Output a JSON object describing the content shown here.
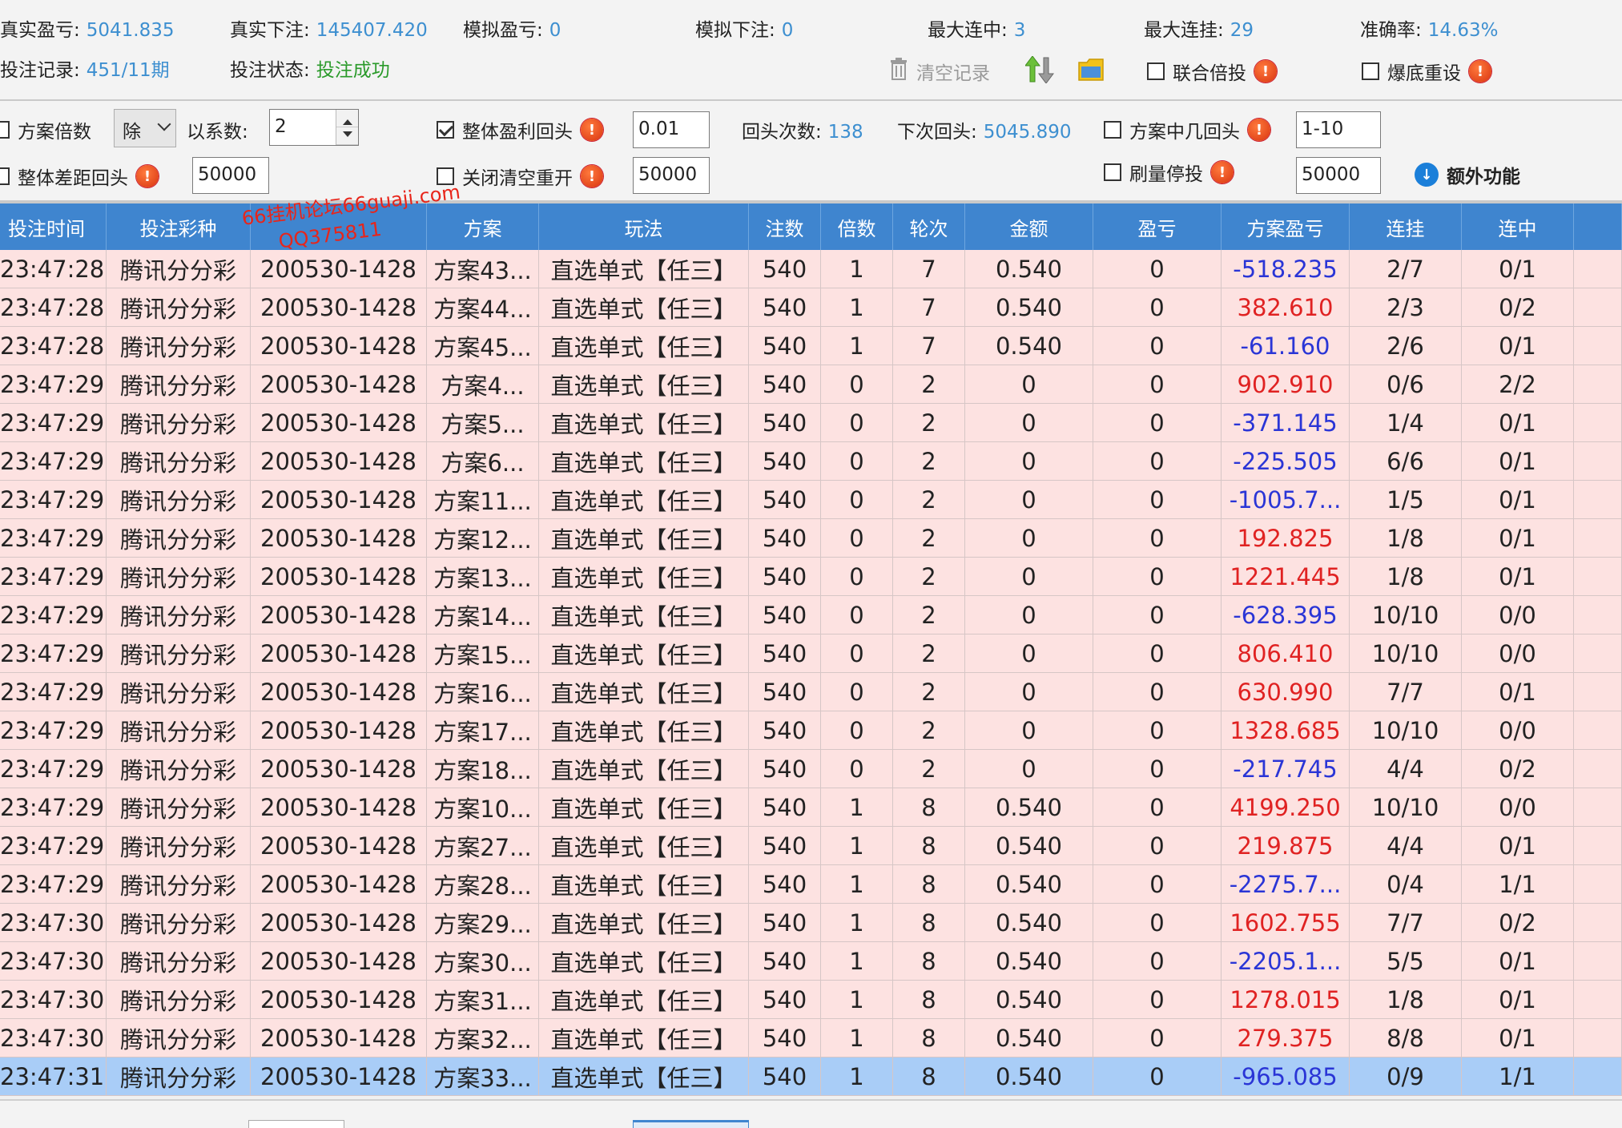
{
  "stats": {
    "real_profit_label": "真实盈亏:",
    "real_profit": "5041.835",
    "real_bet_label": "真实下注:",
    "real_bet": "145407.420",
    "sim_profit_label": "模拟盈亏:",
    "sim_profit": "0",
    "sim_bet_label": "模拟下注:",
    "sim_bet": "0",
    "max_win_streak_label": "最大连中:",
    "max_win_streak": "3",
    "max_loss_streak_label": "最大连挂:",
    "max_loss_streak": "29",
    "accuracy_label": "准确率:",
    "accuracy": "14.63%",
    "bet_record_label": "投注记录:",
    "bet_record": "451/11期",
    "bet_status_label": "投注状态:",
    "bet_status": "投注成功"
  },
  "toolbar": {
    "clear_records": "清空记录",
    "joint_multiplier": "联合倍投",
    "full_reset": "爆底重设"
  },
  "settings": {
    "plan_multiplier_label": "方案倍数",
    "divide_select": "除",
    "coefficient_label": "以系数:",
    "coefficient_value": "2",
    "overall_profit_return_label": "整体盈利回头",
    "overall_profit_return_value": "0.01",
    "return_count_label": "回头次数:",
    "return_count": "138",
    "next_return_label": "下次回头:",
    "next_return": "5045.890",
    "plan_hit_return_label": "方案中几回头",
    "plan_hit_return_value": "1-10",
    "overall_gap_return_label": "整体差距回头",
    "overall_gap_return_value": "50000",
    "close_clear_reopen_label": "关闭清空重开",
    "close_clear_reopen_value": "50000",
    "volume_stop_label": "刷量停投",
    "volume_stop_value": "50000",
    "extra_functions": "额外功能"
  },
  "watermark": {
    "line1": "66挂机论坛66guaji.com",
    "line2": "QQ375811"
  },
  "table": {
    "columns": [
      "投注时间",
      "投注彩种",
      "",
      "方案",
      "玩法",
      "注数",
      "倍数",
      "轮次",
      "金额",
      "盈亏",
      "方案盈亏",
      "连挂",
      "连中",
      ""
    ],
    "rows": [
      [
        "23:47:28",
        "腾讯分分彩",
        "200530-1428",
        "方案43...",
        "直选单式【任三】",
        "540",
        "1",
        "7",
        "0.540",
        "0",
        "-518.235",
        "2/7",
        "0/1"
      ],
      [
        "23:47:28",
        "腾讯分分彩",
        "200530-1428",
        "方案44...",
        "直选单式【任三】",
        "540",
        "1",
        "7",
        "0.540",
        "0",
        "382.610",
        "2/3",
        "0/2"
      ],
      [
        "23:47:28",
        "腾讯分分彩",
        "200530-1428",
        "方案45...",
        "直选单式【任三】",
        "540",
        "1",
        "7",
        "0.540",
        "0",
        "-61.160",
        "2/6",
        "0/1"
      ],
      [
        "23:47:29",
        "腾讯分分彩",
        "200530-1428",
        "方案4...",
        "直选单式【任三】",
        "540",
        "0",
        "2",
        "0",
        "0",
        "902.910",
        "0/6",
        "2/2"
      ],
      [
        "23:47:29",
        "腾讯分分彩",
        "200530-1428",
        "方案5...",
        "直选单式【任三】",
        "540",
        "0",
        "2",
        "0",
        "0",
        "-371.145",
        "1/4",
        "0/1"
      ],
      [
        "23:47:29",
        "腾讯分分彩",
        "200530-1428",
        "方案6...",
        "直选单式【任三】",
        "540",
        "0",
        "2",
        "0",
        "0",
        "-225.505",
        "6/6",
        "0/1"
      ],
      [
        "23:47:29",
        "腾讯分分彩",
        "200530-1428",
        "方案11...",
        "直选单式【任三】",
        "540",
        "0",
        "2",
        "0",
        "0",
        "-1005.7...",
        "1/5",
        "0/1"
      ],
      [
        "23:47:29",
        "腾讯分分彩",
        "200530-1428",
        "方案12...",
        "直选单式【任三】",
        "540",
        "0",
        "2",
        "0",
        "0",
        "192.825",
        "1/8",
        "0/1"
      ],
      [
        "23:47:29",
        "腾讯分分彩",
        "200530-1428",
        "方案13...",
        "直选单式【任三】",
        "540",
        "0",
        "2",
        "0",
        "0",
        "1221.445",
        "1/8",
        "0/1"
      ],
      [
        "23:47:29",
        "腾讯分分彩",
        "200530-1428",
        "方案14...",
        "直选单式【任三】",
        "540",
        "0",
        "2",
        "0",
        "0",
        "-628.395",
        "10/10",
        "0/0"
      ],
      [
        "23:47:29",
        "腾讯分分彩",
        "200530-1428",
        "方案15...",
        "直选单式【任三】",
        "540",
        "0",
        "2",
        "0",
        "0",
        "806.410",
        "10/10",
        "0/0"
      ],
      [
        "23:47:29",
        "腾讯分分彩",
        "200530-1428",
        "方案16...",
        "直选单式【任三】",
        "540",
        "0",
        "2",
        "0",
        "0",
        "630.990",
        "7/7",
        "0/1"
      ],
      [
        "23:47:29",
        "腾讯分分彩",
        "200530-1428",
        "方案17...",
        "直选单式【任三】",
        "540",
        "0",
        "2",
        "0",
        "0",
        "1328.685",
        "10/10",
        "0/0"
      ],
      [
        "23:47:29",
        "腾讯分分彩",
        "200530-1428",
        "方案18...",
        "直选单式【任三】",
        "540",
        "0",
        "2",
        "0",
        "0",
        "-217.745",
        "4/4",
        "0/2"
      ],
      [
        "23:47:29",
        "腾讯分分彩",
        "200530-1428",
        "方案10...",
        "直选单式【任三】",
        "540",
        "1",
        "8",
        "0.540",
        "0",
        "4199.250",
        "10/10",
        "0/0"
      ],
      [
        "23:47:29",
        "腾讯分分彩",
        "200530-1428",
        "方案27...",
        "直选单式【任三】",
        "540",
        "1",
        "8",
        "0.540",
        "0",
        "219.875",
        "4/4",
        "0/1"
      ],
      [
        "23:47:29",
        "腾讯分分彩",
        "200530-1428",
        "方案28...",
        "直选单式【任三】",
        "540",
        "1",
        "8",
        "0.540",
        "0",
        "-2275.7...",
        "0/4",
        "1/1"
      ],
      [
        "23:47:30",
        "腾讯分分彩",
        "200530-1428",
        "方案29...",
        "直选单式【任三】",
        "540",
        "1",
        "8",
        "0.540",
        "0",
        "1602.755",
        "7/7",
        "0/2"
      ],
      [
        "23:47:30",
        "腾讯分分彩",
        "200530-1428",
        "方案30...",
        "直选单式【任三】",
        "540",
        "1",
        "8",
        "0.540",
        "0",
        "-2205.1...",
        "5/5",
        "0/1"
      ],
      [
        "23:47:30",
        "腾讯分分彩",
        "200530-1428",
        "方案31...",
        "直选单式【任三】",
        "540",
        "1",
        "8",
        "0.540",
        "0",
        "1278.015",
        "1/8",
        "0/1"
      ],
      [
        "23:47:30",
        "腾讯分分彩",
        "200530-1428",
        "方案32...",
        "直选单式【任三】",
        "540",
        "1",
        "8",
        "0.540",
        "0",
        "279.375",
        "8/8",
        "0/1"
      ],
      [
        "23:47:31",
        "腾讯分分彩",
        "200530-1428",
        "方案33...",
        "直选单式【任三】",
        "540",
        "1",
        "8",
        "0.540",
        "0",
        "-965.085",
        "0/9",
        "1/1"
      ]
    ],
    "selected_row": 21
  },
  "colors": {
    "header_bg": "#3f85cf",
    "row_bg": "#fde2e1",
    "selected_bg": "#a9cdf7",
    "value_blue": "#3d8fd0",
    "status_green": "#2a9a2a",
    "profit_pos": "#e02222",
    "profit_neg": "#2a35d6"
  },
  "icons": {
    "trash": "trash-icon",
    "up_down": "up-down-arrows-icon",
    "folder": "folder-icon",
    "warning": "warning-icon",
    "info": "info-down-icon"
  }
}
